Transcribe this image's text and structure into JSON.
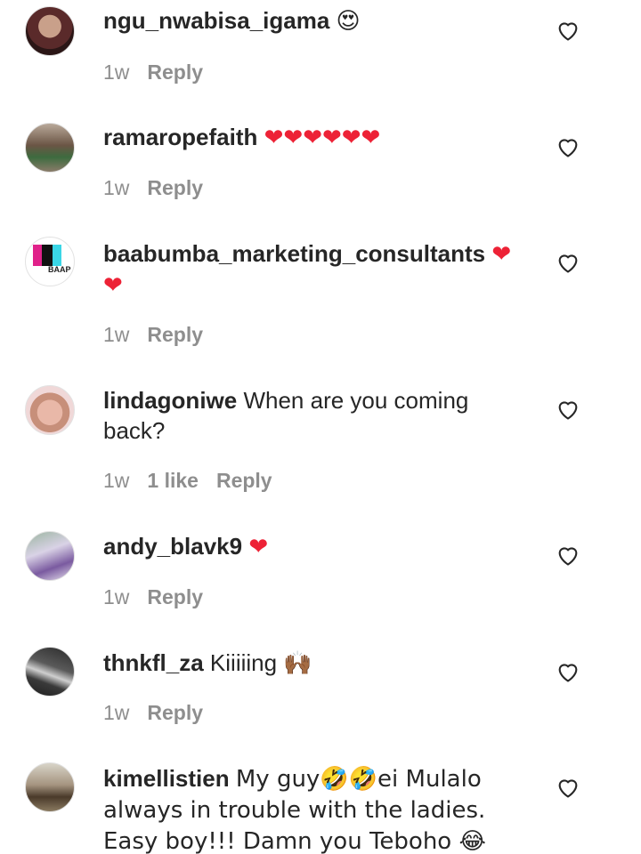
{
  "comments": [
    {
      "username": "ngu_nwabisa_igama",
      "text": "",
      "emoji": "😍",
      "time": "1w",
      "likes": "",
      "reply_label": "Reply",
      "avatar_icon": "user-avatar-icon"
    },
    {
      "username": "ramaropefaith",
      "text": "",
      "emoji": "❤❤❤❤❤❤",
      "time": "1w",
      "likes": "",
      "reply_label": "Reply",
      "avatar_icon": "user-avatar-icon"
    },
    {
      "username": "baabumba_marketing_consultants",
      "text": "",
      "emoji": "❤ ❤",
      "time": "1w",
      "likes": "",
      "reply_label": "Reply",
      "avatar_icon": "brand-logo-icon",
      "avatar_text": "BAAP"
    },
    {
      "username": "lindagoniwe",
      "text": "When are you coming back?",
      "emoji": "",
      "time": "1w",
      "likes": "1 like",
      "reply_label": "Reply",
      "avatar_icon": "user-avatar-icon"
    },
    {
      "username": "andy_blavk9",
      "text": "",
      "emoji": "❤",
      "time": "1w",
      "likes": "",
      "reply_label": "Reply",
      "avatar_icon": "user-avatar-icon"
    },
    {
      "username": "thnkfl_za",
      "text": "Kiiiiing",
      "emoji": "🙌🏾",
      "time": "1w",
      "likes": "",
      "reply_label": "Reply",
      "avatar_icon": "user-avatar-icon"
    },
    {
      "username": "kimellistien",
      "text": "My guy🤣🤣ei Mulalo always in trouble with the ladies. Easy boy!!! Damn you Teboho 😂",
      "emoji": "",
      "time": "",
      "likes": "",
      "reply_label": "",
      "avatar_icon": "user-avatar-icon"
    }
  ],
  "colors": {
    "text": "#262626",
    "meta": "#8e8e8e",
    "heart": "#ed2236",
    "background": "#ffffff"
  }
}
